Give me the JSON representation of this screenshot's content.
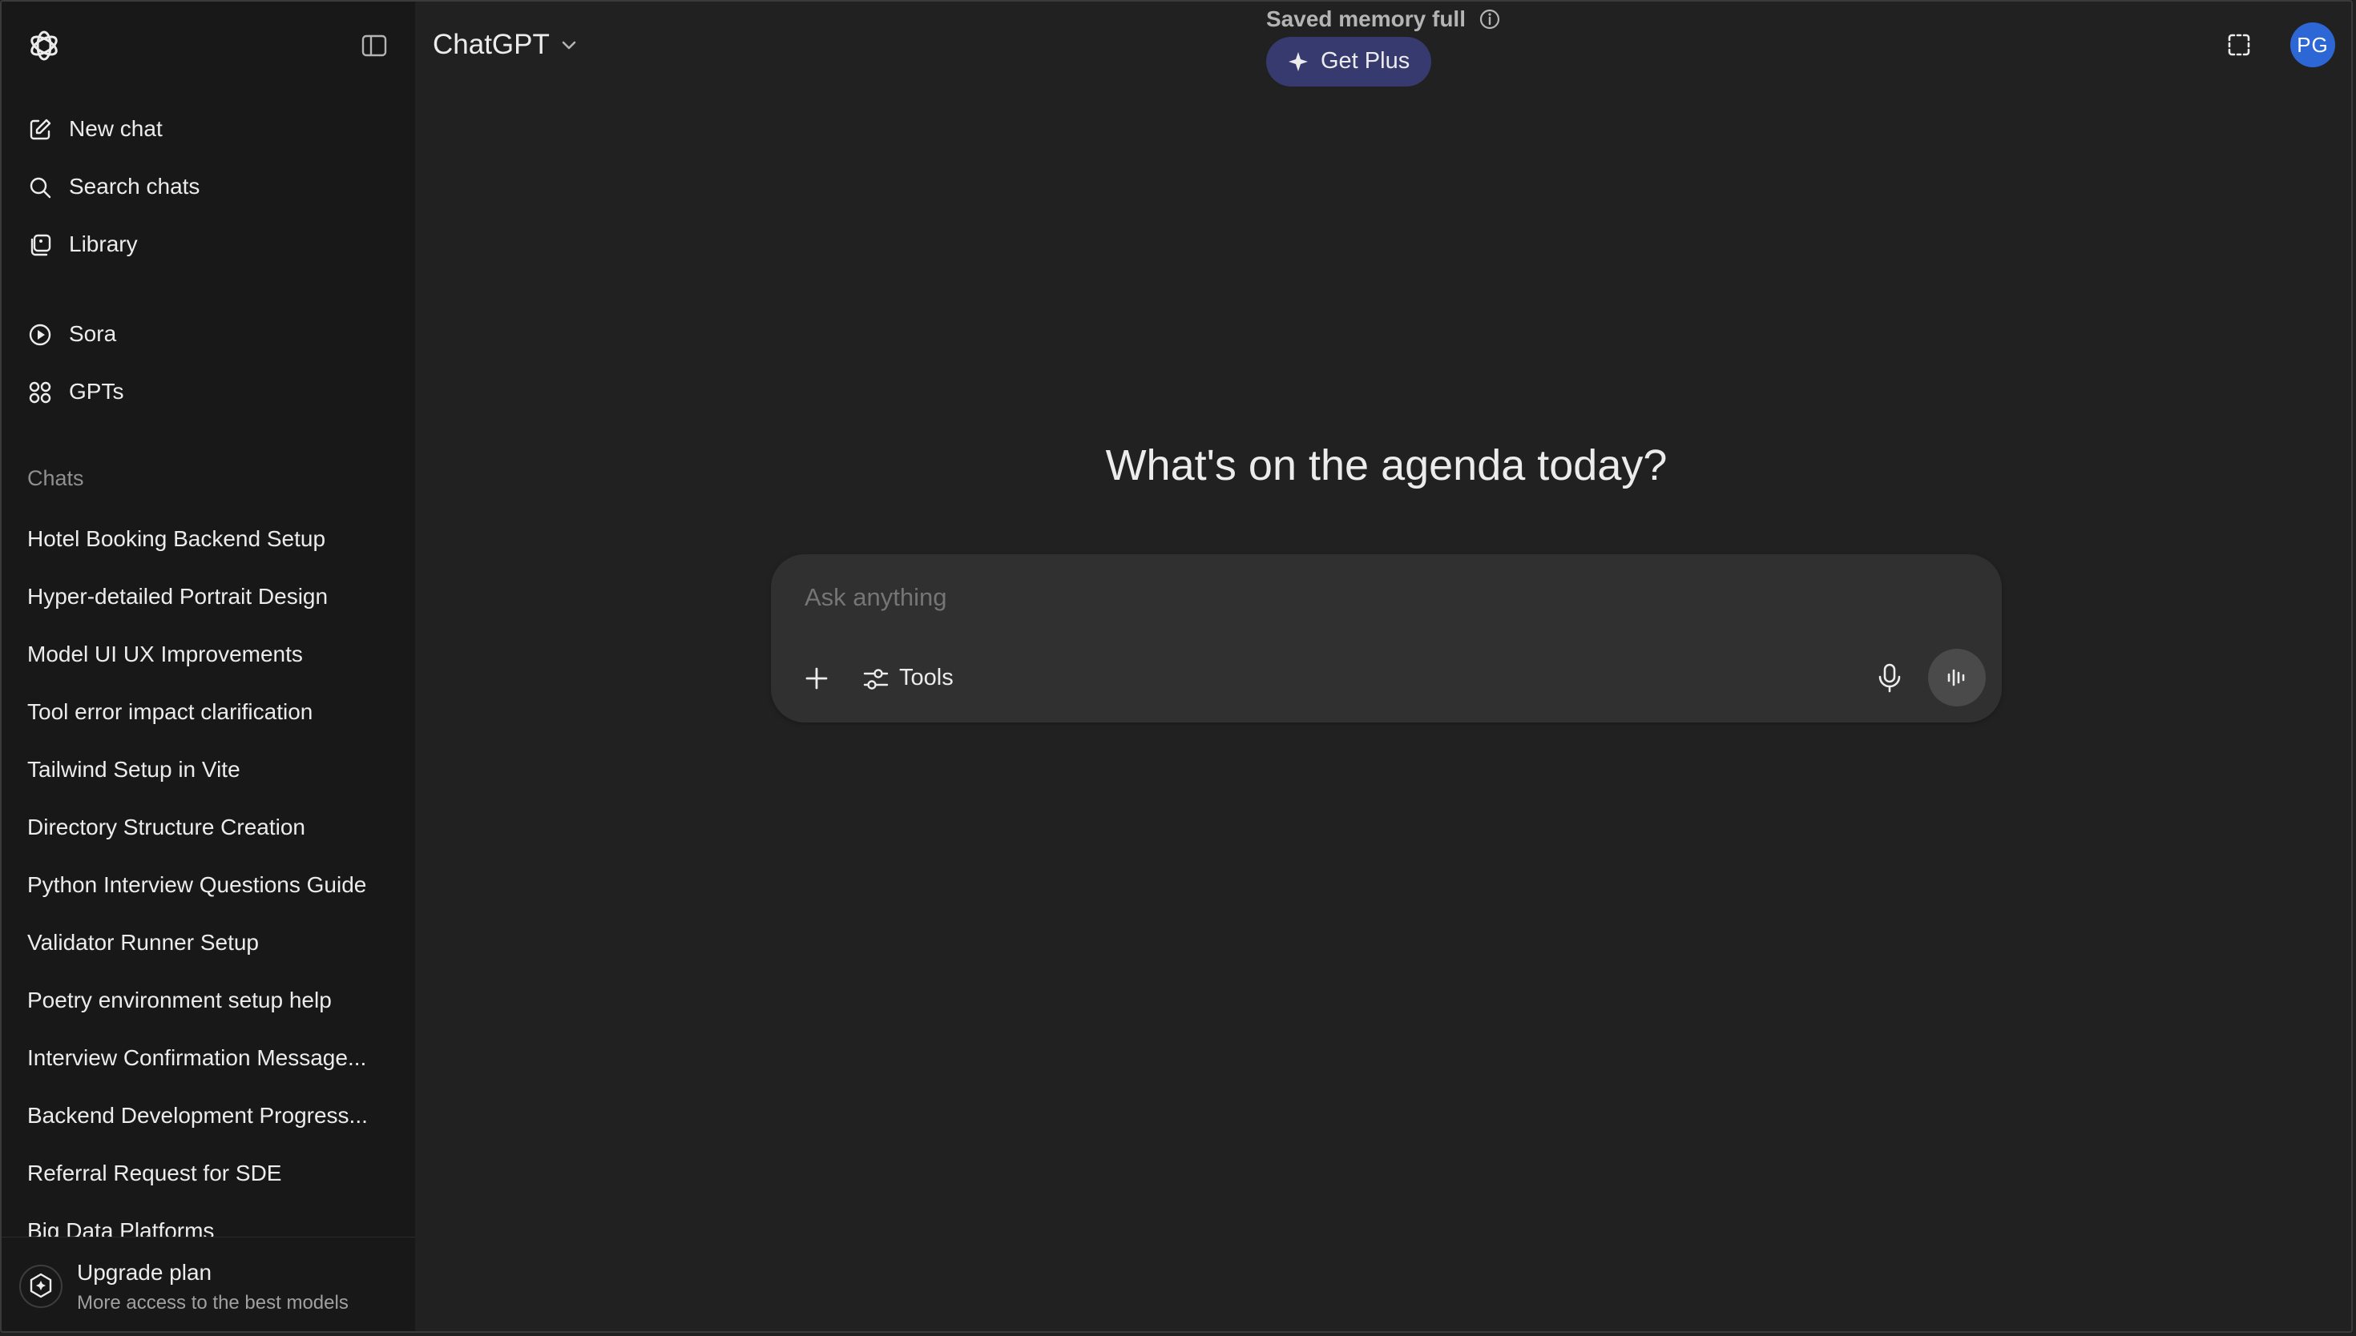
{
  "sidebar": {
    "nav": [
      {
        "label": "New chat",
        "icon": "new-chat-icon"
      },
      {
        "label": "Search chats",
        "icon": "search-icon"
      },
      {
        "label": "Library",
        "icon": "library-icon"
      }
    ],
    "apps": [
      {
        "label": "Sora",
        "icon": "play-circle-icon"
      },
      {
        "label": "GPTs",
        "icon": "grid-icon"
      }
    ],
    "section_title": "Chats",
    "chats": [
      "Hotel Booking Backend Setup",
      "Hyper-detailed Portrait Design",
      "Model UI UX Improvements",
      "Tool error impact clarification",
      "Tailwind Setup in Vite",
      "Directory Structure Creation",
      "Python Interview Questions Guide",
      "Validator Runner Setup",
      "Poetry environment setup help",
      "Interview Confirmation Message...",
      "Backend Development Progress...",
      "Referral Request for SDE",
      "Big Data Platforms"
    ],
    "upgrade": {
      "title": "Upgrade plan",
      "subtitle": "More access to the best models"
    }
  },
  "header": {
    "model": "ChatGPT",
    "memory_notice": "Saved memory full",
    "get_plus": "Get Plus",
    "avatar_initials": "PG"
  },
  "main": {
    "headline": "What's on the agenda today?",
    "composer": {
      "placeholder": "Ask anything",
      "tools_label": "Tools"
    }
  },
  "colors": {
    "background": "#212121",
    "sidebar": "#181818",
    "composer": "#303030",
    "get_plus": "#373a6e",
    "avatar": "#2d67d6"
  }
}
